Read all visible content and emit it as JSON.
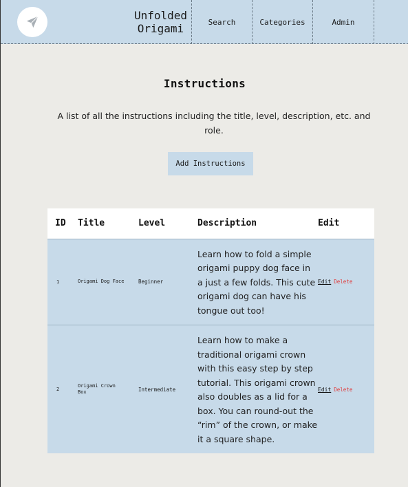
{
  "header": {
    "brand": "Unfolded\nOrigami",
    "nav": [
      {
        "label": "Search"
      },
      {
        "label": "Categories"
      },
      {
        "label": "Admin"
      }
    ]
  },
  "main": {
    "title": "Instructions",
    "description": "A list of all the instructions including the title, level, description, etc. and role.",
    "add_button": "Add Instructions"
  },
  "table": {
    "headers": {
      "id": "ID",
      "title": "Title",
      "level": "Level",
      "description": "Description",
      "edit": "Edit"
    },
    "rows": [
      {
        "id": "1",
        "title": "Origami Dog Face",
        "level": "Beginner",
        "description": "Learn how to fold a simple origami puppy dog face in a just a few folds. This cute origami dog can have his tongue out too!",
        "edit": "Edit",
        "delete": "Delete"
      },
      {
        "id": "2",
        "title": "Origami Crown Box",
        "level": "Intermediate",
        "description": "Learn how to make a traditional origami crown with this easy step by step tutorial. This origami crown also doubles as a lid for a box. You can round-out the “rim” of the crown, or make it a square shape.",
        "edit": "Edit",
        "delete": "Delete"
      }
    ]
  },
  "colors": {
    "header_bg": "#c7dae9",
    "page_bg": "#ecebe7",
    "delete": "#e03a3a"
  },
  "icons": {
    "logo": "paper-plane-icon"
  }
}
